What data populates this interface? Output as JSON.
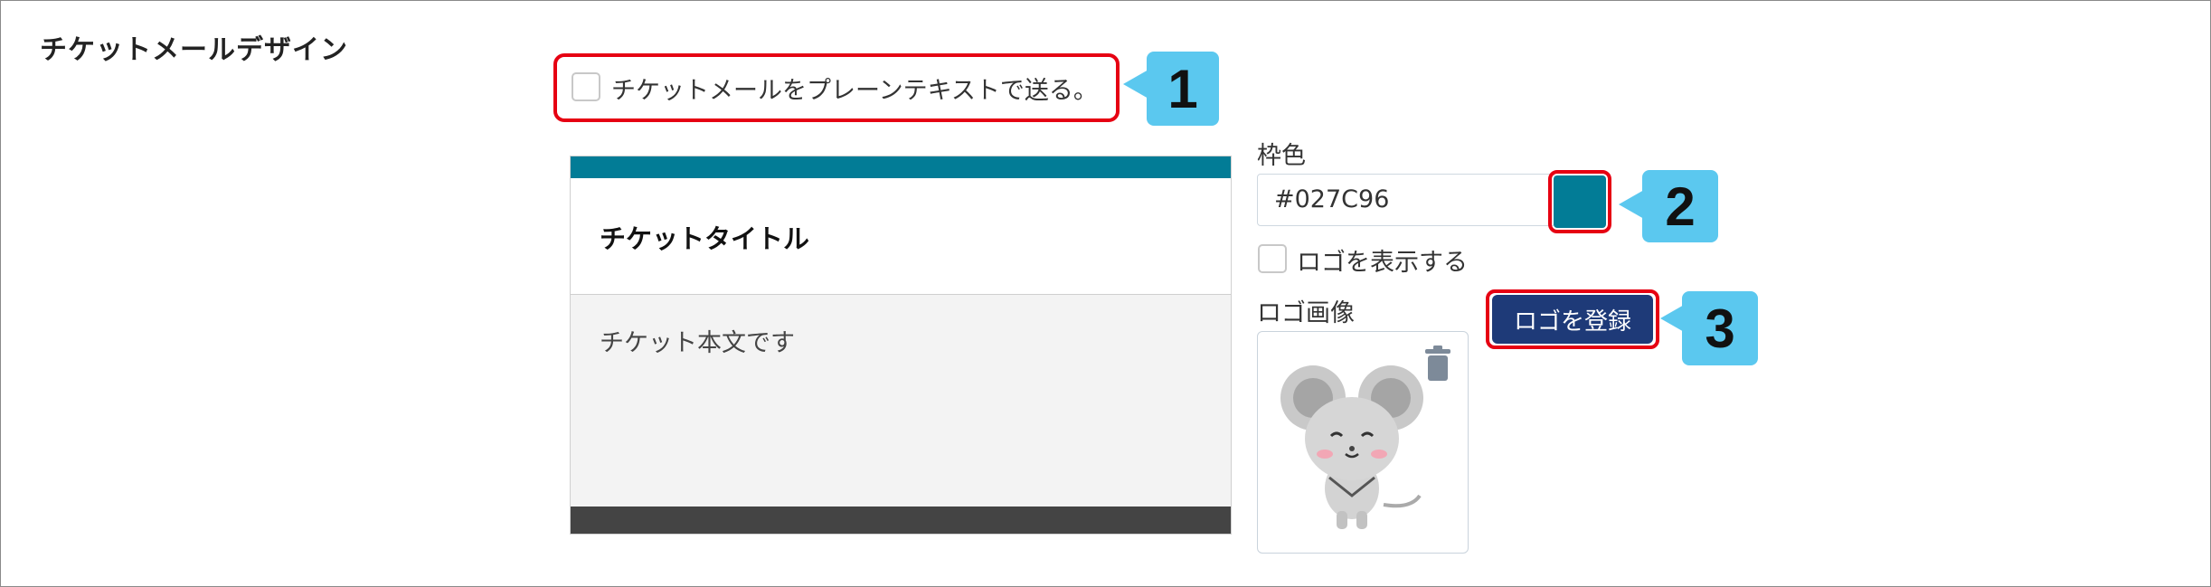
{
  "section": {
    "title": "チケットメールデザイン"
  },
  "plaintext": {
    "label": "チケットメールをプレーンテキストで送る。",
    "checked": false
  },
  "preview": {
    "title": "チケットタイトル",
    "body": "チケット本文です"
  },
  "frame_color": {
    "label": "枠色",
    "value": "#027C96"
  },
  "show_logo": {
    "label": "ロゴを表示する",
    "checked": false
  },
  "logo_image": {
    "label": "ロゴ画像",
    "register_label": "ロゴを登録"
  },
  "callouts": [
    "1",
    "2",
    "3"
  ],
  "colors": {
    "accent": "#027C96",
    "highlight": "#e60012",
    "callout": "#5bc8ef",
    "button": "#1e3a78"
  }
}
